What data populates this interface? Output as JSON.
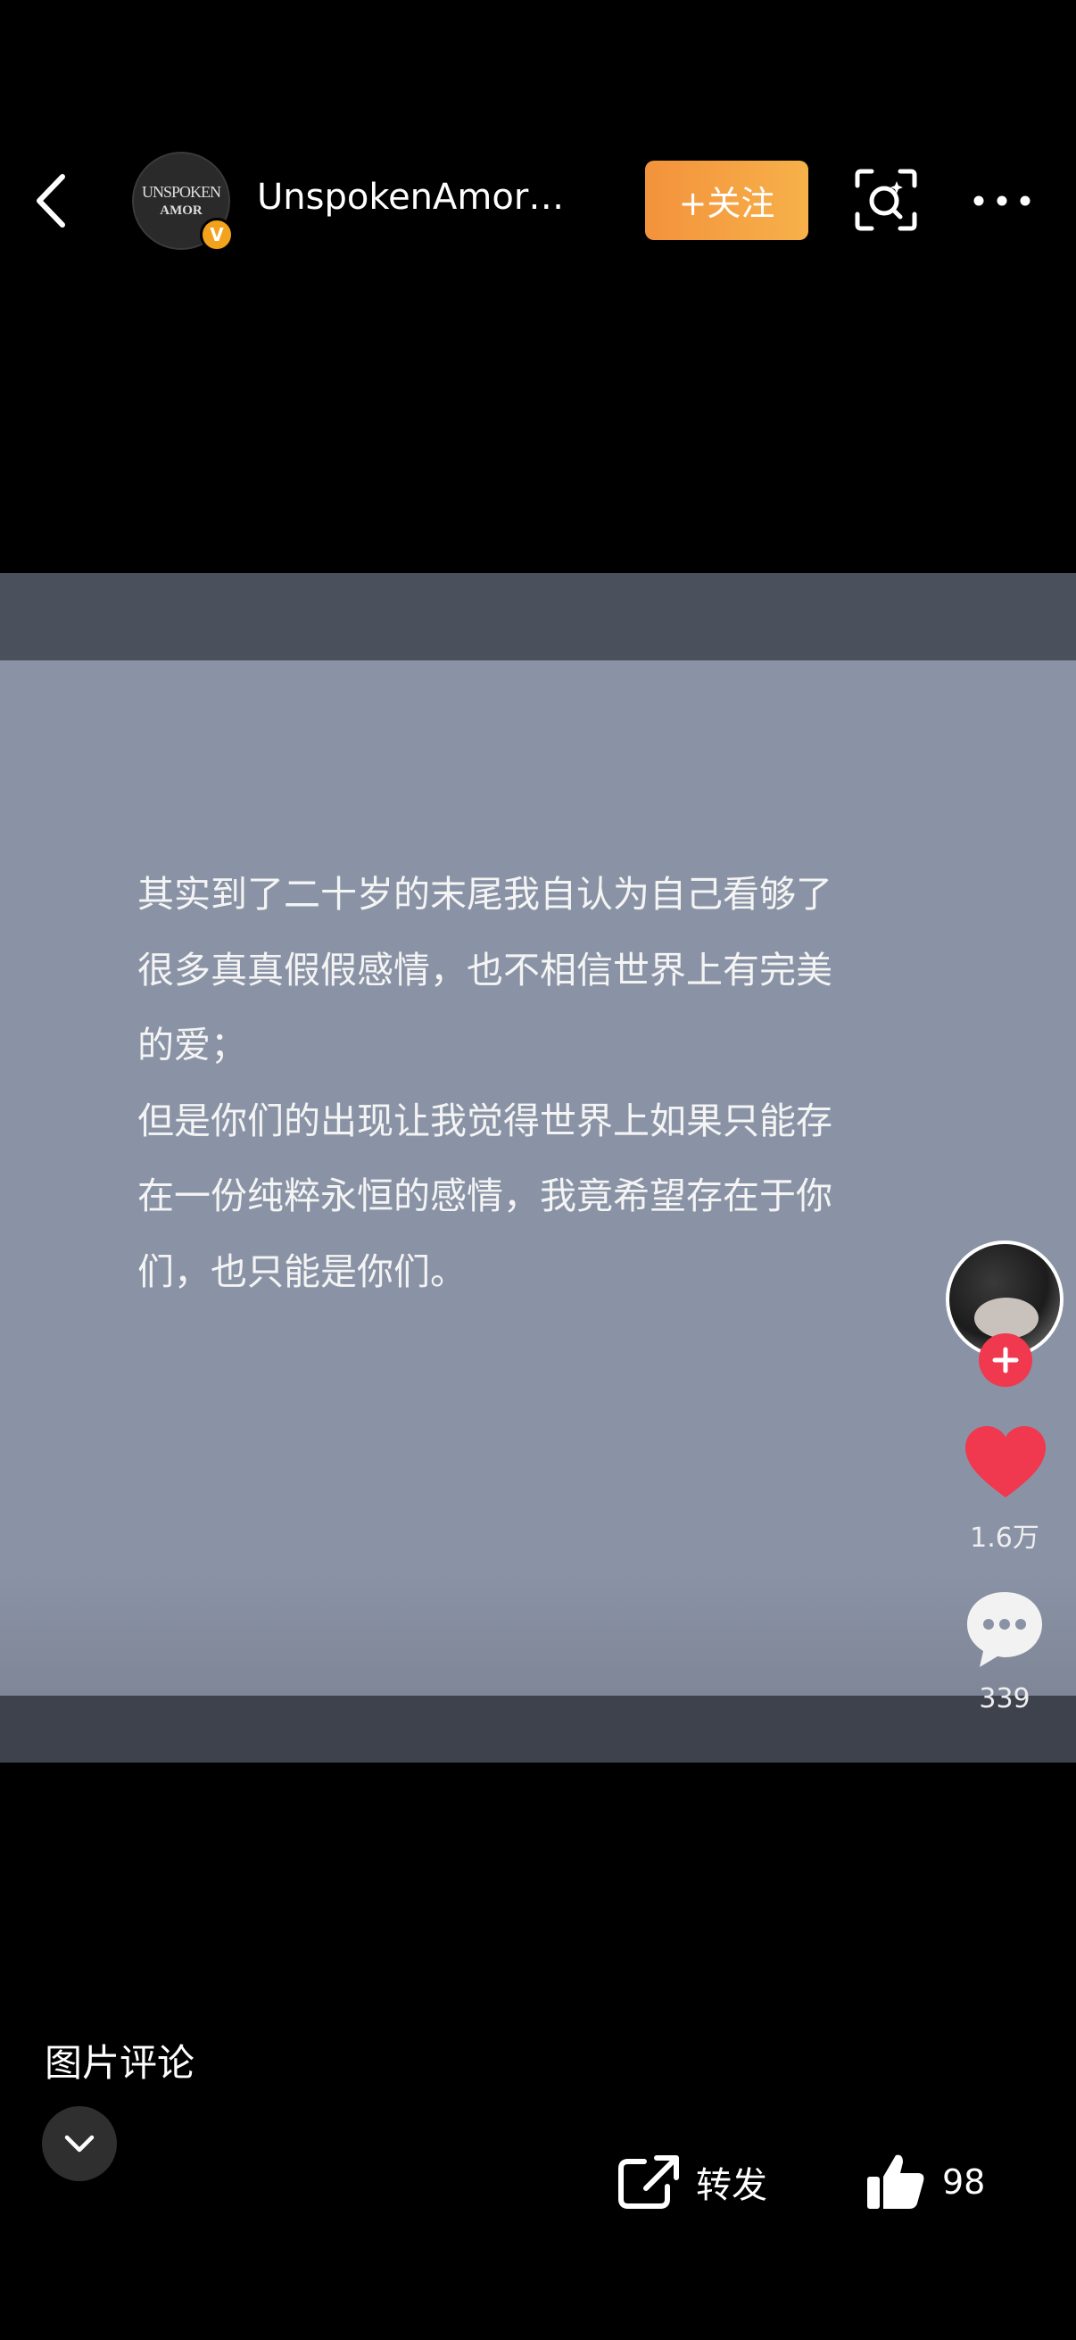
{
  "header": {
    "avatar_lines": [
      "UNSPOKEN",
      "AMOR"
    ],
    "verified_badge": "V",
    "username": "UnspokenAmor…",
    "follow_label": "+关注",
    "icons": [
      "back-arrow-icon",
      "scan-icon",
      "more-icon"
    ]
  },
  "post": {
    "lines": [
      "其实到了二十岁的末尾我自认为自己看够了",
      "很多真真假假感情，也不相信世界上有完美",
      "的爱；",
      "但是你们的出现让我觉得世界上如果只能存",
      "在一份纯粹永恒的感情，我竟希望存在于你",
      "们，也只能是你们。"
    ]
  },
  "actions": {
    "likes": "1.6万",
    "comments": "339",
    "like_color": "#f0384f",
    "icons": [
      "profile-avatar",
      "plus-icon",
      "heart-icon",
      "comment-icon"
    ]
  },
  "footer": {
    "image_comment_label": "图片评论",
    "share_label": "转发",
    "like_count": "98",
    "icons": [
      "chevron-down-icon",
      "share-icon",
      "thumbs-up-icon"
    ]
  },
  "colors": {
    "follow_button": "#f3923c",
    "card_background": "#8a93a5",
    "verified": "#f2a31b"
  }
}
